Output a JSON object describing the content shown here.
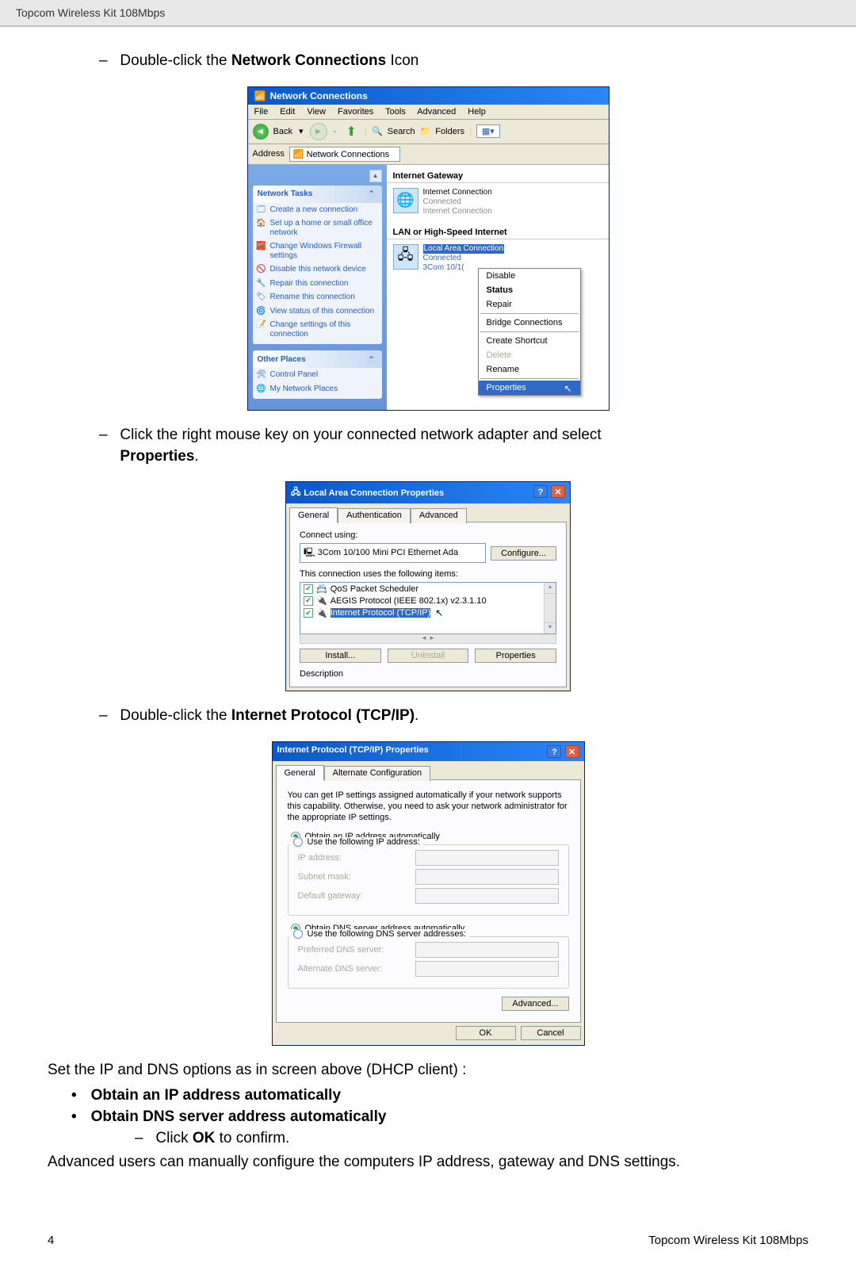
{
  "doc": {
    "product": "Topcom Wireless Kit 108Mbps",
    "page_number": "4",
    "step1": "Double-click the ",
    "step1_bold": "Network Connections",
    "step1_tail": " Icon",
    "step2a": "Click the right mouse key on your connected network adapter and select ",
    "step2b": "Properties",
    "step2c": ".",
    "step3a": "Double-click the ",
    "step3b": "Internet Protocol (TCP/IP)",
    "step3c": ".",
    "setline": "Set the IP and DNS options as in screen above (DHCP client) :",
    "obt1": "Obtain an IP address automatically",
    "obt2": "Obtain DNS server address automatically",
    "clickok_a": "Click ",
    "clickok_b": "OK",
    "clickok_c": " to confirm.",
    "advtext": "Advanced users can manually configure the computers IP address, gateway and DNS settings."
  },
  "nc": {
    "title": "Network Connections",
    "menus": [
      "File",
      "Edit",
      "View",
      "Favorites",
      "Tools",
      "Advanced",
      "Help"
    ],
    "toolbar": {
      "back": "Back",
      "search": "Search",
      "folders": "Folders"
    },
    "address_label": "Address",
    "address_value": "Network Connections",
    "sidebar": {
      "tasks_header": "Network Tasks",
      "tasks": [
        "Create a new connection",
        "Set up a home or small office network",
        "Change Windows Firewall settings",
        "Disable this network device",
        "Repair this connection",
        "Rename this connection",
        "View status of this connection",
        "Change settings of this connection"
      ],
      "other_header": "Other Places",
      "other": [
        "Control Panel",
        "My Network Places"
      ]
    },
    "groups": {
      "gateway": "Internet Gateway",
      "lan": "LAN or High-Speed Internet"
    },
    "conn1": {
      "title": "Internet Connection",
      "status": "Connected",
      "sub": "Internet Connection"
    },
    "conn2": {
      "title": "Local Area Connection",
      "status": "Connected",
      "sub": "3Com 10/1("
    },
    "context": [
      "Disable",
      "Status",
      "Repair",
      "Bridge Connections",
      "Create Shortcut",
      "Delete",
      "Rename",
      "Properties"
    ]
  },
  "lan": {
    "title": "Local Area Connection Properties",
    "tabs": [
      "General",
      "Authentication",
      "Advanced"
    ],
    "connect_using": "Connect using:",
    "adapter": "3Com 10/100 Mini PCI Ethernet Ada",
    "configure": "Configure...",
    "uses": "This connection uses the following items:",
    "items": [
      "QoS Packet Scheduler",
      "AEGIS Protocol (IEEE 802.1x) v2.3.1.10",
      "Internet Protocol (TCP/IP)"
    ],
    "install": "Install...",
    "uninstall": "Uninstall",
    "properties": "Properties",
    "description": "Description"
  },
  "tcp": {
    "title": "Internet Protocol (TCP/IP) Properties",
    "tabs": [
      "General",
      "Alternate Configuration"
    ],
    "desc": "You can get IP settings assigned automatically if your network supports this capability. Otherwise, you need to ask your network administrator for the appropriate IP settings.",
    "r1": "Obtain an IP address automatically",
    "r2": "Use the following IP address:",
    "ip_label": "IP address:",
    "subnet_label": "Subnet mask:",
    "gateway_label": "Default gateway:",
    "r3": "Obtain DNS server address automatically",
    "r4": "Use the following DNS server addresses:",
    "pref_dns": "Preferred DNS server:",
    "alt_dns": "Alternate DNS server:",
    "advanced": "Advanced...",
    "ok": "OK",
    "cancel": "Cancel"
  }
}
